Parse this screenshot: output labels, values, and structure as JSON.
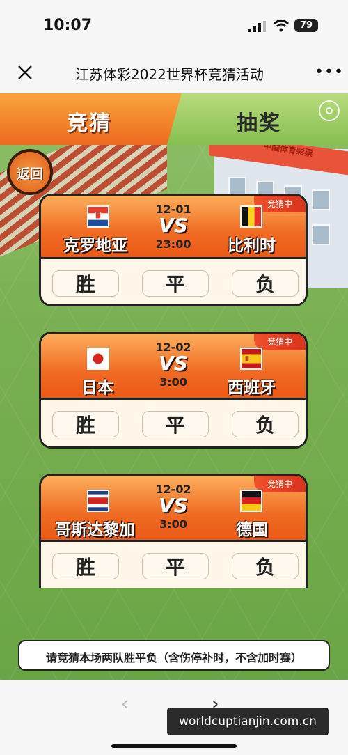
{
  "status": {
    "time": "10:07",
    "battery": "79"
  },
  "nav": {
    "title": "江苏体彩2022世界杯竞猜活动"
  },
  "tabs": {
    "guess": "竞猜",
    "lottery": "抽奖"
  },
  "back": "返回",
  "scene": {
    "sign": "中国体育彩票"
  },
  "matches": [
    {
      "badge": "竞猜中",
      "date": "12-01",
      "vs": "VS",
      "time": "23:00",
      "home": {
        "name": "克罗地亚",
        "flag": "croatia-flag"
      },
      "away": {
        "name": "比利时",
        "flag": "belgium-flag"
      },
      "options": [
        "胜",
        "平",
        "负"
      ]
    },
    {
      "badge": "竞猜中",
      "date": "12-02",
      "vs": "VS",
      "time": "3:00",
      "home": {
        "name": "日本",
        "flag": "japan-flag"
      },
      "away": {
        "name": "西班牙",
        "flag": "spain-flag"
      },
      "options": [
        "胜",
        "平",
        "负"
      ]
    },
    {
      "badge": "竞猜中",
      "date": "12-02",
      "vs": "VS",
      "time": "3:00",
      "home": {
        "name": "哥斯达黎加",
        "flag": "costa-rica-flag"
      },
      "away": {
        "name": "德国",
        "flag": "germany-flag"
      },
      "options": [
        "胜",
        "平",
        "负"
      ]
    }
  ],
  "note": "请竞猜本场两队胜平负（含伤停补时，不含加时赛）",
  "watermark": "worldcuptianjin.com.cn",
  "colors": {
    "orange": "#f06b22",
    "green": "#79b052"
  }
}
